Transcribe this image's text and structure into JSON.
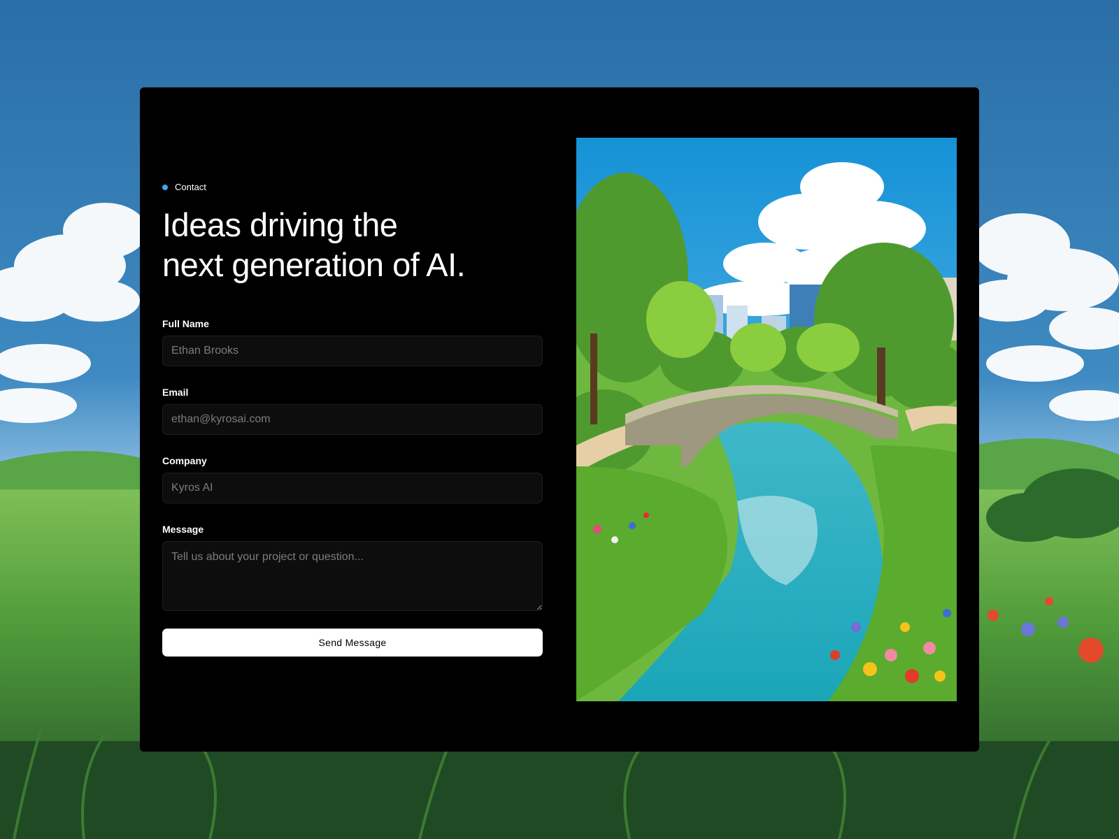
{
  "contact": {
    "eyebrow": "Contact",
    "headline_line1": "Ideas driving the",
    "headline_line2": "next generation of AI."
  },
  "form": {
    "full_name": {
      "label": "Full Name",
      "placeholder": "Ethan Brooks"
    },
    "email": {
      "label": "Email",
      "placeholder": "ethan@kyrosai.com"
    },
    "company": {
      "label": "Company",
      "placeholder": "Kyros AI"
    },
    "message": {
      "label": "Message",
      "placeholder": "Tell us about your project or question..."
    },
    "submit_label": "Send Message"
  },
  "colors": {
    "accent_dot": "#3ea6f0",
    "card_background": "#000000",
    "field_background": "#0d0d0d",
    "button_background": "#ffffff"
  },
  "icons": {
    "eyebrow_marker": "dot-icon",
    "textarea_resize": "resize-handle-icon"
  }
}
